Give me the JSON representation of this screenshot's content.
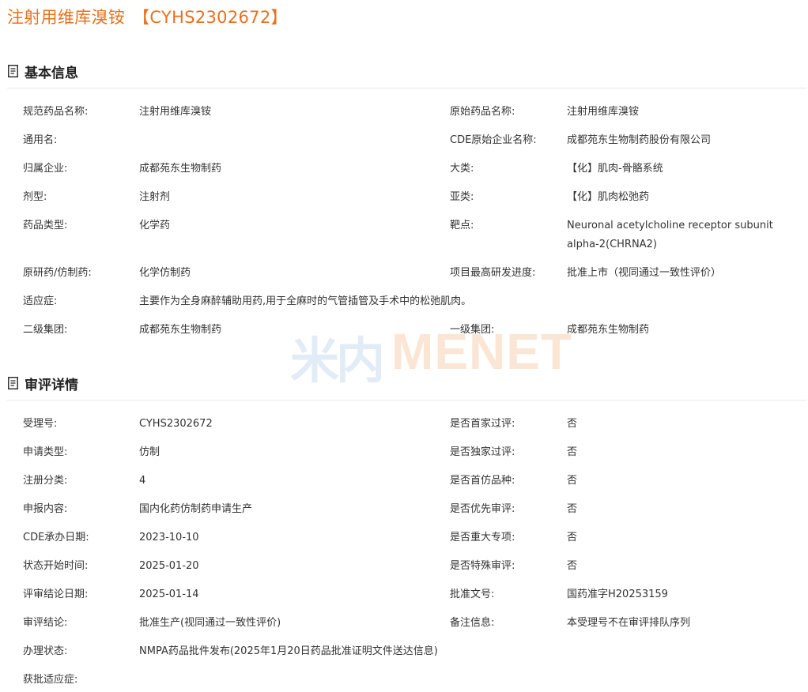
{
  "header": {
    "title": "注射用维库溴铵",
    "code": "【CYHS2302672】"
  },
  "basic_info": {
    "section_title": "基本信息",
    "icon": "document-icon",
    "rows": [
      {
        "label_left": "规范药品名称:",
        "value_left": "注射用维库溴铵",
        "label_right": "原始药品名称:",
        "value_right": "注射用维库溴铵"
      },
      {
        "label_left": "通用名:",
        "value_left": "",
        "label_right": "CDE原始企业名称:",
        "value_right": "成都苑东生物制药股份有限公司"
      },
      {
        "label_left": "归属企业:",
        "value_left": "成都苑东生物制药",
        "label_right": "大类:",
        "value_right": "【化】肌肉-骨骼系统"
      },
      {
        "label_left": "剂型:",
        "value_left": "注射剂",
        "label_right": "亚类:",
        "value_right": "【化】肌肉松弛药"
      },
      {
        "label_left": "药品类型:",
        "value_left": "化学药",
        "label_right": "靶点:",
        "value_right": "Neuronal acetylcholine receptor subunit alpha-2(CHRNA2)"
      },
      {
        "label_left": "原研药/仿制药:",
        "value_left": "化学仿制药",
        "label_right": "项目最高研发进度:",
        "value_right": "批准上市（视同通过一致性评价）"
      },
      {
        "label_left": "适应症:",
        "value_left": "主要作为全身麻醉辅助用药,用于全麻时的气管插管及手术中的松弛肌肉。",
        "label_right": "",
        "value_right": ""
      },
      {
        "label_left": "二级集团:",
        "value_left": "成都苑东生物制药",
        "label_right": "一级集团:",
        "value_right": "成都苑东生物制药"
      }
    ]
  },
  "review_details": {
    "section_title": "审评详情",
    "icon": "document-icon",
    "rows": [
      {
        "label_left": "受理号:",
        "value_left": "CYHS2302672",
        "label_right": "是否首家过评:",
        "value_right": "否"
      },
      {
        "label_left": "申请类型:",
        "value_left": "仿制",
        "label_right": "是否独家过评:",
        "value_right": "否"
      },
      {
        "label_left": "注册分类:",
        "value_left": "4",
        "label_right": "是否首仿品种:",
        "value_right": "否"
      },
      {
        "label_left": "申报内容:",
        "value_left": "国内化药仿制药申请生产",
        "label_right": "是否优先审评:",
        "value_right": "否"
      },
      {
        "label_left": "CDE承办日期:",
        "value_left": "2023-10-10",
        "label_right": "是否重大专项:",
        "value_right": "否"
      },
      {
        "label_left": "状态开始时间:",
        "value_left": "2025-01-20",
        "label_right": "是否特殊审评:",
        "value_right": "否"
      },
      {
        "label_left": "评审结论日期:",
        "value_left": "2025-01-14",
        "label_right": "批准文号:",
        "value_right": "国药准字H20253159"
      },
      {
        "label_left": "审评结论:",
        "value_left": "批准生产(视同通过一致性评价)",
        "label_right": "备注信息:",
        "value_right": "本受理号不在审评排队序列"
      },
      {
        "label_left": "办理状态:",
        "value_left": "NMPA药品批件发布(2025年1月20日药品批准证明文件送达信息)",
        "label_right": "",
        "value_right": ""
      },
      {
        "label_left": "获批适应症:",
        "value_left": "",
        "label_right": "",
        "value_right": ""
      }
    ]
  },
  "watermark": {
    "cn": "米内",
    "en": "MENET"
  },
  "colors": {
    "title": "#e8711d",
    "text": "#333333",
    "divider": "#e8e8e8"
  }
}
